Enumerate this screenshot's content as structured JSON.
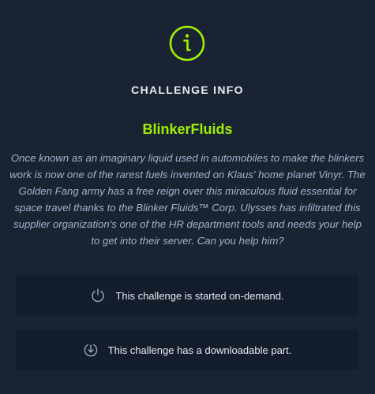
{
  "header": {
    "icon": "info-icon",
    "title": "CHALLENGE INFO"
  },
  "challenge": {
    "name": "BlinkerFluids",
    "description": "Once known as an imaginary liquid used in automobiles to make the blinkers work is now one of the rarest fuels invented on Klaus' home planet Vinyr. The Golden Fang army has a free reign over this miraculous fluid essential for space travel thanks to the Blinker Fluids™ Corp. Ulysses has infiltrated this supplier organization's one of the HR department tools and needs your help to get into their server. Can you help him?"
  },
  "notices": {
    "on_demand": {
      "icon": "power-icon",
      "text": "This challenge is started on-demand."
    },
    "download": {
      "icon": "download-icon",
      "text": "This challenge has a downloadable part."
    }
  },
  "colors": {
    "background": "#1a2332",
    "card": "#141d2b",
    "accent": "#9fef00",
    "text": "#e6ebf2",
    "muted": "#a4b1cd"
  }
}
